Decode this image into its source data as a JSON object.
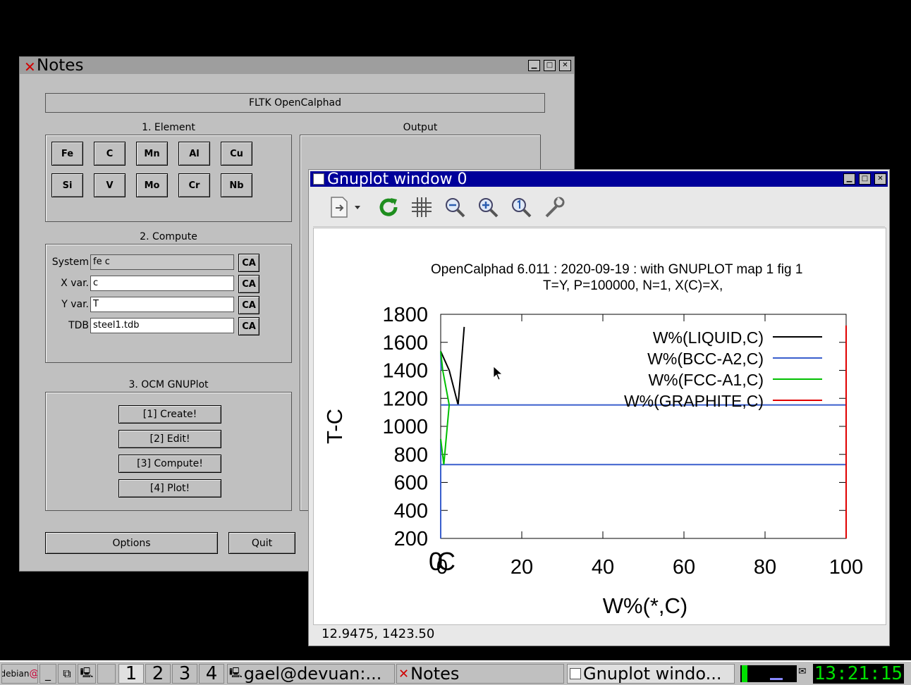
{
  "notes_window": {
    "title": "Notes",
    "app_title": "FLTK OpenCalphad",
    "element_group": {
      "label": "1. Element",
      "elements": [
        "Fe",
        "C",
        "Mn",
        "Al",
        "Cu",
        "Si",
        "V",
        "Mo",
        "Cr",
        "Nb"
      ]
    },
    "output_group": {
      "label": "Output"
    },
    "compute_group": {
      "label": "2. Compute",
      "fields": [
        {
          "label": "System",
          "value": "fe c",
          "button": "CA"
        },
        {
          "label": "X var.",
          "value": "c",
          "button": "CA"
        },
        {
          "label": "Y var.",
          "value": "T",
          "button": "CA"
        },
        {
          "label": "TDB",
          "value": "steel1.tdb",
          "button": "CA"
        }
      ]
    },
    "gnuplot_group": {
      "label": "3. OCM GNUPlot",
      "buttons": [
        "[1] Create!",
        "[2] Edit!",
        "[3] Compute!",
        "[4] Plot!"
      ]
    },
    "options_label": "Options",
    "quit_label": "Quit"
  },
  "gnuplot_window": {
    "title": "Gnuplot window 0",
    "toolbar": [
      "export-icon",
      "replot-icon",
      "grid-icon",
      "zoom-out-icon",
      "zoom-in-icon",
      "zoom-reset-icon",
      "settings-icon"
    ],
    "status": "12.9475,  1423.50"
  },
  "chart_data": {
    "type": "line",
    "title": "OpenCalphad   6.011 :  2020-09-19 : with GNUPLOT map 1 fig 1",
    "subtitle": "T=Y,  P=100000, N=1, X(C)=X,",
    "xlabel": "W%(*,C)",
    "ylabel": "T-C",
    "xlim": [
      0,
      100
    ],
    "ylim": [
      200,
      1800
    ],
    "xticks": [
      "0",
      "20",
      "40",
      "60",
      "80",
      "100"
    ],
    "yticks": [
      "200",
      "400",
      "600",
      "800",
      "1000",
      "1200",
      "1400",
      "1600",
      "1800"
    ],
    "origin_label": "0C",
    "legend_position": "top-right",
    "series": [
      {
        "name": "W%(LIQUID,C)",
        "color": "#000000",
        "x": [
          0,
          2.1,
          4.3,
          5.8
        ],
        "y": [
          1536,
          1400,
          1153,
          1710
        ]
      },
      {
        "name": "W%(BCC-A2,C)",
        "color": "#3a5fcd",
        "x": [
          0,
          0.1,
          0,
          0.02,
          100,
          0.02,
          0.1
        ],
        "y": [
          1536,
          1400,
          910,
          727,
          727,
          727,
          1153
        ],
        "segments": [
          [
            [
              0,
              1536
            ],
            [
              0.1,
              1400
            ]
          ],
          [
            [
              0,
              910
            ],
            [
              0.02,
              727
            ]
          ],
          [
            [
              0,
              1153
            ],
            [
              100,
              1153
            ]
          ],
          [
            [
              0,
              727
            ],
            [
              100,
              727
            ]
          ],
          [
            [
              0,
              200
            ],
            [
              0,
              727
            ]
          ]
        ]
      },
      {
        "name": "W%(FCC-A1,C)",
        "color": "#00c000",
        "x": [
          0,
          0.5,
          2.1,
          0.77,
          0
        ],
        "y": [
          1536,
          1400,
          1153,
          727,
          910
        ]
      },
      {
        "name": "W%(GRAPHITE,C)",
        "color": "#e00000",
        "x": [
          100,
          100
        ],
        "y": [
          200,
          1720
        ]
      }
    ]
  },
  "taskbar": {
    "menu_label": "debian",
    "desktops": [
      "1",
      "2",
      "3",
      "4"
    ],
    "tasks": [
      "gael@devuan:...",
      "Notes",
      "Gnuplot windo..."
    ],
    "clock": "13:21:15"
  }
}
